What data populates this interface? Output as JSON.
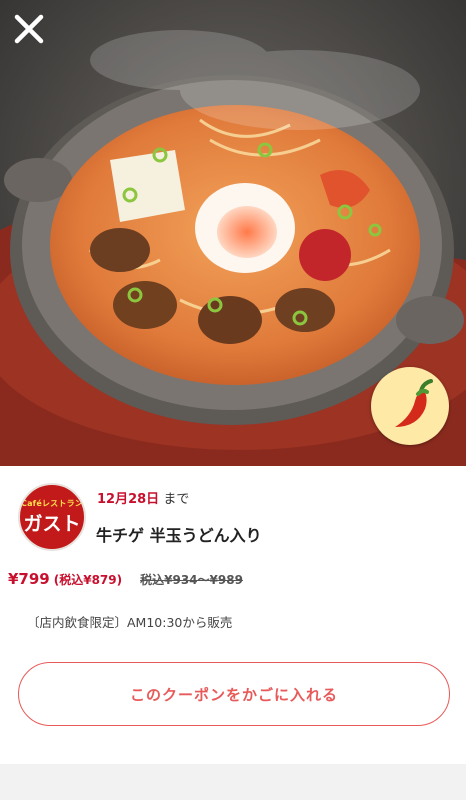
{
  "header": {
    "close_icon": "close-icon"
  },
  "hero": {
    "image": "dish-photo",
    "badge_icon": "chili-pepper-icon"
  },
  "shop": {
    "logo_small": "Caféレストラン",
    "logo_name": "ガスト",
    "brand_color": "#c8102e"
  },
  "coupon": {
    "expiry_date": "12月28日",
    "expiry_suffix": "まで",
    "product_name": "牛チゲ 半玉うどん入り",
    "price": "¥799",
    "price_tax": "(税込¥879)",
    "original_price": "税込¥934〜¥989",
    "note": "〔店内飲食限定〕AM10:30から販売",
    "cta_label": "このクーポンをかごに入れる",
    "cta_color": "#e85a5a"
  }
}
